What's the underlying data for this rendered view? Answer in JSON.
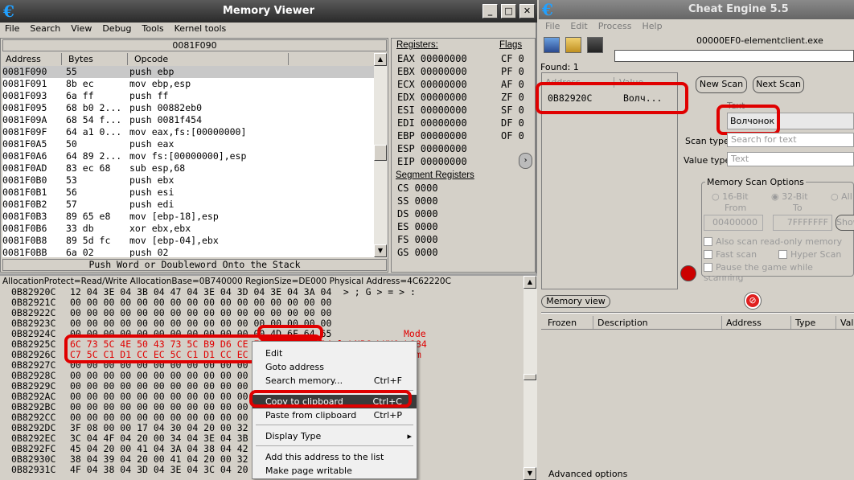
{
  "mv": {
    "title": "Memory Viewer",
    "menu": [
      "File",
      "Search",
      "View",
      "Debug",
      "Tools",
      "Kernel tools"
    ],
    "address_bar": "0081F090",
    "cols": {
      "address": "Address",
      "bytes": "Bytes",
      "opcode": "Opcode"
    },
    "disasm": [
      {
        "a": "0081F090",
        "b": "55",
        "o": "push ebp"
      },
      {
        "a": "0081F091",
        "b": "8b ec",
        "o": "mov ebp,esp"
      },
      {
        "a": "0081F093",
        "b": "6a ff",
        "o": "push ff"
      },
      {
        "a": "0081F095",
        "b": "68 b0 2...",
        "o": "push 00882eb0"
      },
      {
        "a": "0081F09A",
        "b": "68 54 f...",
        "o": "push 0081f454"
      },
      {
        "a": "0081F09F",
        "b": "64 a1 0...",
        "o": "mov eax,fs:[00000000]"
      },
      {
        "a": "0081F0A5",
        "b": "50",
        "o": "push eax"
      },
      {
        "a": "0081F0A6",
        "b": "64 89 2...",
        "o": "mov fs:[00000000],esp"
      },
      {
        "a": "0081F0AD",
        "b": "83 ec 68",
        "o": "sub esp,68"
      },
      {
        "a": "0081F0B0",
        "b": "53",
        "o": "push ebx"
      },
      {
        "a": "0081F0B1",
        "b": "56",
        "o": "push esi"
      },
      {
        "a": "0081F0B2",
        "b": "57",
        "o": "push edi"
      },
      {
        "a": "0081F0B3",
        "b": "89 65 e8",
        "o": "mov [ebp-18],esp"
      },
      {
        "a": "0081F0B6",
        "b": "33 db",
        "o": "xor ebx,ebx"
      },
      {
        "a": "0081F0B8",
        "b": "89 5d fc",
        "o": "mov [ebp-04],ebx"
      },
      {
        "a": "0081F0BB",
        "b": "6a 02",
        "o": "push 02"
      }
    ],
    "status": "Push Word or Doubleword Onto the Stack",
    "reg_label": "Registers:",
    "flags_label": "Flags",
    "registers": [
      "EAX 00000000",
      "EBX 00000000",
      "ECX 00000000",
      "EDX 00000000",
      "ESI 00000000",
      "EDI 00000000",
      "EBP 00000000",
      "ESP 00000000",
      "EIP 00000000"
    ],
    "flags": [
      "CF 0",
      "PF 0",
      "AF 0",
      "ZF 0",
      "SF 0",
      "DF 0",
      "OF 0"
    ],
    "seg_label": "Segment Registers",
    "segments": [
      "CS 0000",
      "SS 0000",
      "DS 0000",
      "ES 0000",
      "FS 0000",
      "GS 0000"
    ],
    "alloc_info": "AllocationProtect=Read/Write AllocationBase=0B740000 RegionSize=DE000 Physical Address=4C62220C",
    "hex": [
      {
        "a": "0B82920C",
        "h": "12 04 3E 04 3B 04 47 04 3E 04 3D 04 3E 04 3A 04",
        "t": " > ; G > = > :"
      },
      {
        "a": "0B82921C",
        "h": "00 00 00 00 00 00 00 00 00 00 00 00 00 00 00 00",
        "t": ""
      },
      {
        "a": "0B82922C",
        "h": "00 00 00 00 00 00 00 00 00 00 00 00 00 00 00 00",
        "t": ""
      },
      {
        "a": "0B82923C",
        "h": "00 00 00 00 00 00 00 00 00 00 00 00 00 00 00 00",
        "t": ""
      },
      {
        "a": "0B82924C",
        "h": "00 00 00 00 00 00 00 00 00 00 00 00 4D 6F 64 65",
        "t": "Mode"
      },
      {
        "a": "0B82925C",
        "h": "6C 73 5C 4E 50 43 73 5C B9 D6 CE EF 5C 31 38 34",
        "t": "ls\\NPCs\\ЏЦОп\\184"
      },
      {
        "a": "0B82926C",
        "h": "C7 5C C1 D1 CC EC 5C C1 D1 CC EC 2E 65 63 6D 00",
        "t": "З\\БСМм\\БСМм.ecm"
      },
      {
        "a": "0B82927C",
        "h": "00 00 00 00 00 00 00 00 00 00 00 00 00 00 00 00",
        "t": ""
      },
      {
        "a": "0B82928C",
        "h": "00 00 00 00 00 00 00 00 00 00 00 00 00 00 00 00",
        "t": ""
      },
      {
        "a": "0B82929C",
        "h": "00 00 00 00 00 00 00 00 00 00 00 00 00 00 00 00",
        "t": ""
      },
      {
        "a": "0B8292AC",
        "h": "00 00 00 00 00 00 00 00 00 00 00 00 00 00 00 00",
        "t": ""
      },
      {
        "a": "0B8292BC",
        "h": "00 00 00 00 00 00 00 00 00 00 00 00 00 00 00 00",
        "t": ""
      },
      {
        "a": "0B8292CC",
        "h": "00 00 00 00 00 00 00 00 00 00 00 00 00 00 00 00",
        "t": ""
      },
      {
        "a": "0B8292DC",
        "h": "3F 08 00 00 17 04 30 04 20 00 32 04 3B 04 30 04",
        "t": ""
      },
      {
        "a": "0B8292EC",
        "h": "3C 04 4F 04 20 00 34 04 3E 04 3B 04 33 04 3E 04",
        "t": ""
      },
      {
        "a": "0B8292FC",
        "h": "45 04 20 00 41 04 3A 04 38 04 42 04 30 04 3B 04",
        "t": ""
      },
      {
        "a": "0B82930C",
        "h": "38 04 39 04 20 00 41 04 20 00 32 04 30 04 3C 04",
        "t": ""
      },
      {
        "a": "0B82931C",
        "h": "4F 04 38 04 3D 04 3E 04 3C 04 20 00 38 04 20 00",
        "t": ""
      }
    ],
    "context_menu": [
      {
        "label": "Edit",
        "sc": ""
      },
      {
        "label": "Goto address",
        "sc": ""
      },
      {
        "label": "Search memory...",
        "sc": "Ctrl+F"
      },
      {
        "label": "Copy to clipboard",
        "sc": "Ctrl+C"
      },
      {
        "label": "Paste from clipboard",
        "sc": "Ctrl+P"
      },
      {
        "label": "Display Type",
        "sc": ""
      },
      {
        "label": "Add this address to the list",
        "sc": ""
      },
      {
        "label": "Make page writable",
        "sc": ""
      }
    ]
  },
  "ce": {
    "title": "Cheat Engine 5.5",
    "menu": [
      "File",
      "Edit",
      "Process",
      "Help"
    ],
    "process": "00000EF0-elementclient.exe",
    "found": "Found: 1",
    "found_cols": {
      "address": "Address",
      "value": "Value"
    },
    "found_row": {
      "address": "0B82920C",
      "value": "Волч..."
    },
    "new_scan": "New Scan",
    "next_scan": "Next Scan",
    "text_label": "Text",
    "text_value": "Волчонок",
    "scan_type_label": "Scan type",
    "scan_type_value": "Search for text",
    "value_type_label": "Value type",
    "value_type_value": "Text",
    "mso_title": "Memory Scan Options",
    "bit16": "16-Bit",
    "bit32": "32-Bit",
    "all": "All",
    "from_label": "From",
    "to_label": "To",
    "from_value": "00400000",
    "to_value": "7FFFFFFF",
    "show_btn": "Show",
    "opt_readonly": "Also scan read-only memory",
    "opt_fast": "Fast scan",
    "opt_hyper": "Hyper Scan",
    "opt_pause": "Pause the game while scanning",
    "memory_view_btn": "Memory view",
    "list_cols": [
      "Frozen",
      "Description",
      "Address",
      "Type",
      "Value"
    ],
    "advanced": "Advanced options"
  }
}
